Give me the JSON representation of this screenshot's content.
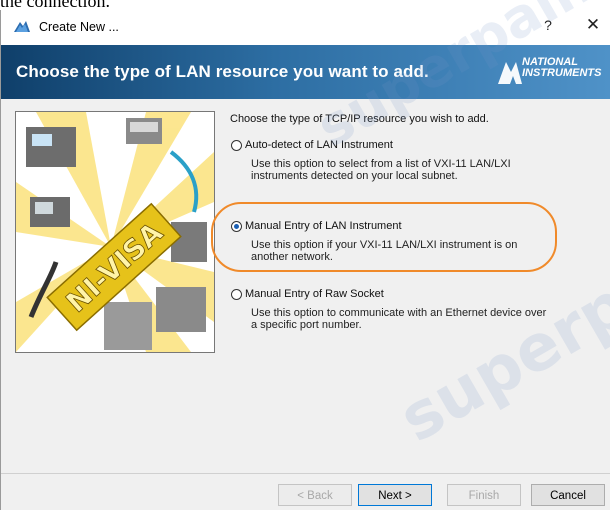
{
  "above_text": "the connection.",
  "window": {
    "title": "Create New ...",
    "help_glyph": "?",
    "close_glyph": "✕"
  },
  "banner": {
    "title": "Choose the type of LAN resource you want to add.",
    "logo_line1": "NATIONAL",
    "logo_line2": "INSTRUMENTS"
  },
  "illustration": {
    "label": "NI-VISA"
  },
  "content": {
    "prompt": "Choose the type of TCP/IP resource you wish to add.",
    "options": [
      {
        "label": "Auto-detect of LAN Instrument",
        "desc": "Use this option to select from a list of VXI-11 LAN/LXI instruments detected on your local subnet.",
        "selected": false
      },
      {
        "label": "Manual Entry of LAN Instrument",
        "desc": "Use this option if your VXI-11 LAN/LXI instrument is on another network.",
        "selected": true
      },
      {
        "label": "Manual Entry of Raw Socket",
        "desc": "Use this option to communicate with an Ethernet device over a specific port number.",
        "selected": false
      }
    ]
  },
  "buttons": {
    "back": "< Back",
    "next": "Next >",
    "finish": "Finish",
    "cancel": "Cancel"
  },
  "watermark": "superpaint",
  "colors": {
    "banner_dark": "#0f3f6a",
    "banner_light": "#4f92c8",
    "highlight": "#f08a2a",
    "radio_dot": "#1a5fb4"
  }
}
